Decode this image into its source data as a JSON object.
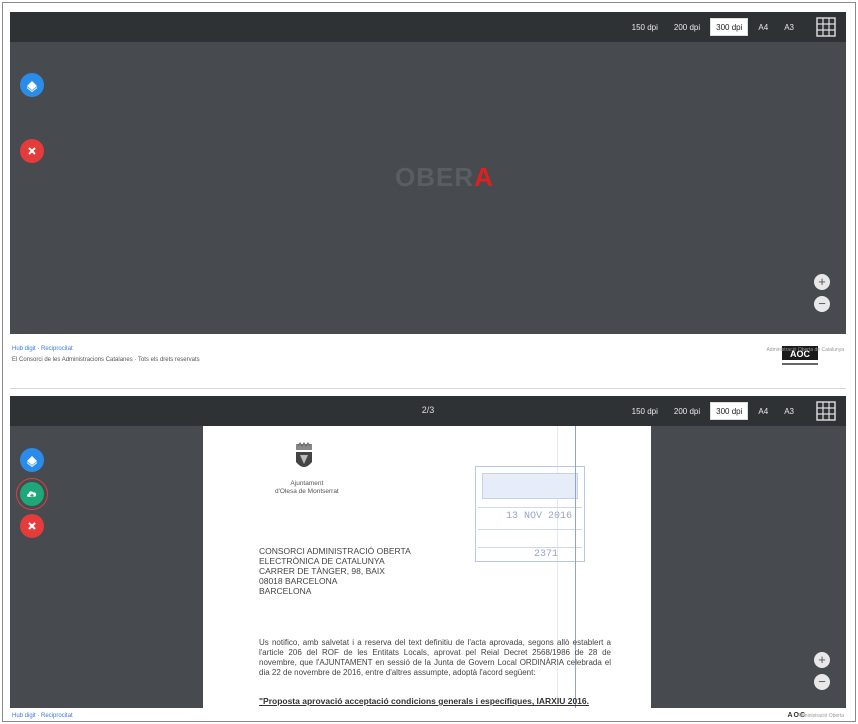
{
  "toolbar": {
    "buttons": [
      "150 dpi",
      "200 dpi",
      "300 dpi",
      "A4",
      "A3"
    ],
    "active_index": 2
  },
  "viewer_top": {
    "splash_faint": "OBER",
    "splash_accent": "A"
  },
  "viewer_bottom": {
    "page_indicator": "2/3"
  },
  "footer_top": {
    "link": "Hub digit · Reciprocitat",
    "description": "El Consorci de les Administracions Catalanes · Tots els drets reservats",
    "logo_text": "AOC",
    "side_text": "Administració Oberta de Catalunya"
  },
  "footer_bottom": {
    "link": "Hub digit · Reciprocitat",
    "logo_text": "AOC",
    "side_text": "Administració Oberta"
  },
  "document": {
    "municipality_line1": "Ajuntament",
    "municipality_line2": "d'Olesa de Montserrat",
    "stamp_date": "13 NOV 2016",
    "stamp_number": "2371",
    "address": [
      "CONSORCI ADMINISTRACIÓ OBERTA",
      "ELECTRÒNICA DE CATALUNYA",
      "CARRER DE TÀNGER, 98, BAIX",
      "08018 BARCELONA",
      "BARCELONA"
    ],
    "body": "Us notifico, amb salvetat i a reserva del text definitiu de l'acta aprovada, segons allò establert a l'article 206 del ROF de les Entitats Locals, aprovat pel Reial Decret 2568/1986 de 28 de novembre, que l'AJUNTAMENT en sessió de la Junta de Govern Local ORDINÀRIA celebrada el dia 22 de novembre de 2016, entre d'altres assumpte, adoptà l'acord següent:",
    "subject": "\"Proposta aprovació acceptació condicions generals i específiques, IARXIU 2016."
  },
  "colors": {
    "panel_bg": "#474a4e",
    "toolbar_bg": "#2f3235",
    "accent_blue": "#2a8ce8",
    "accent_red": "#e53b3b",
    "accent_green": "#1fa77a"
  }
}
